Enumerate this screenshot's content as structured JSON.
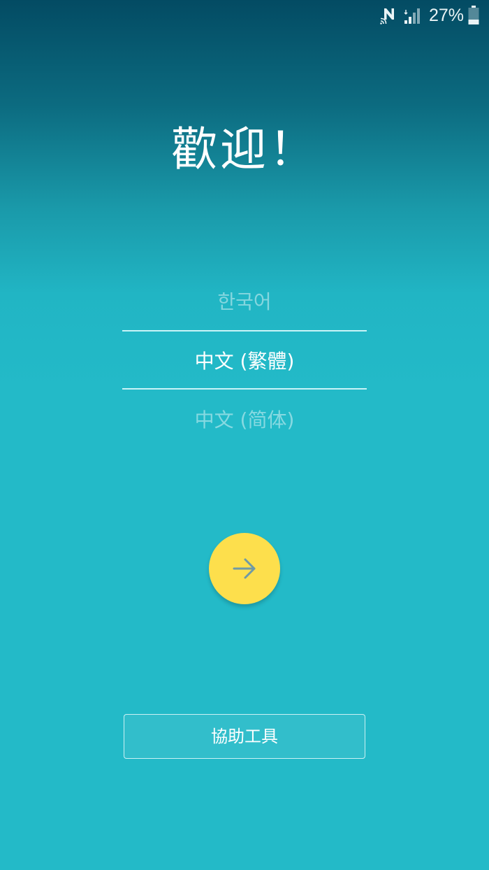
{
  "status_bar": {
    "battery_percent": "27%",
    "icons": [
      "nfc-icon",
      "signal-icon",
      "battery-icon"
    ]
  },
  "title": "歡迎！",
  "language_picker": {
    "previous": "한국어",
    "selected": "中文 (繁體)",
    "next": "中文 (简体)"
  },
  "next_button": {
    "icon": "arrow-right-icon"
  },
  "assist_button": {
    "label": "協助工具"
  },
  "colors": {
    "background_top": "#034b63",
    "background_main": "#23bac8",
    "fab": "#fddf4c",
    "fab_arrow": "#6f9aa6"
  }
}
